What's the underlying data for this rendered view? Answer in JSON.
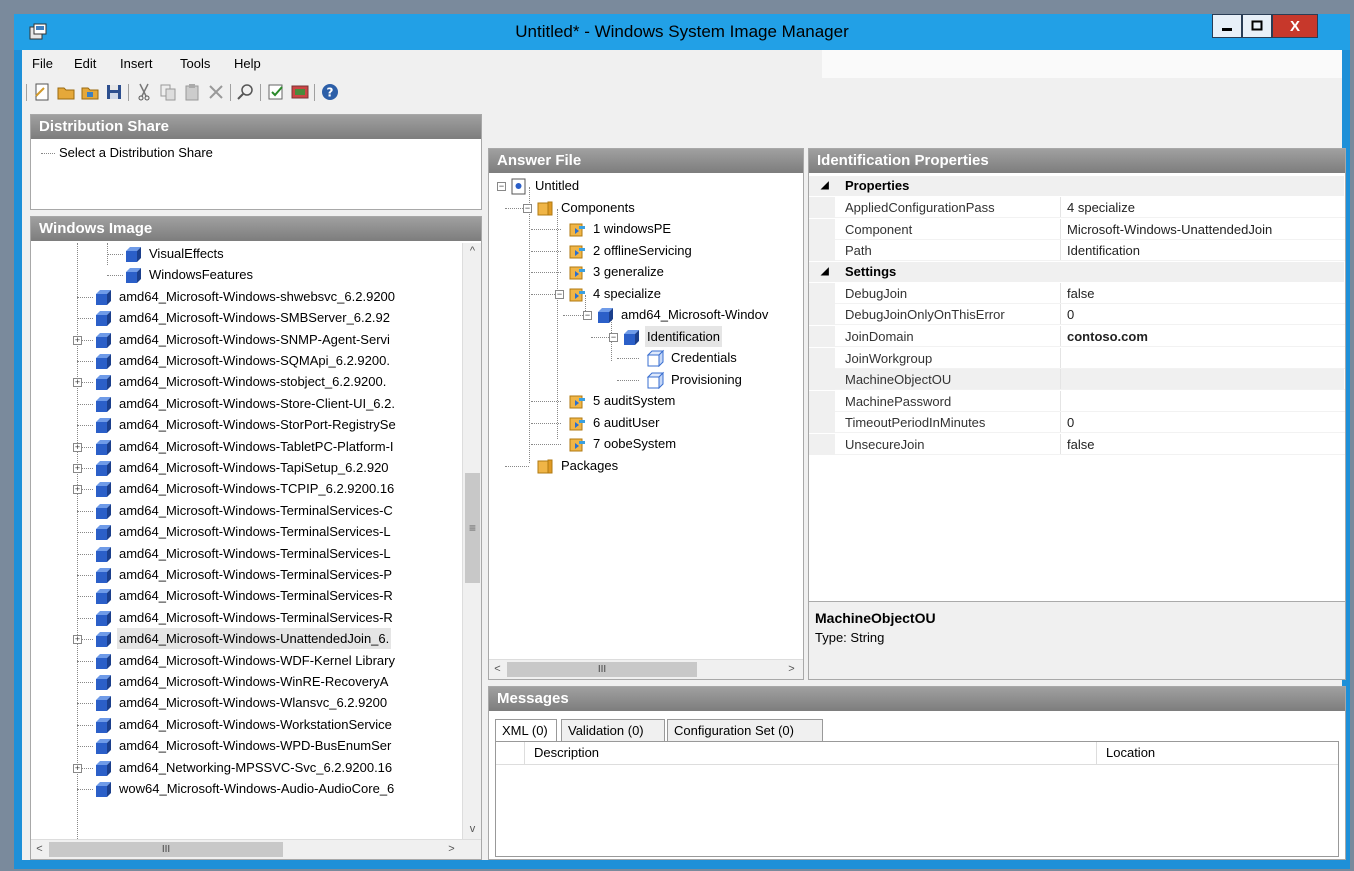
{
  "window": {
    "title": "Untitled* - Windows System Image Manager",
    "close_glyph": "X",
    "accent_color": "#22a0e6"
  },
  "menu": [
    "File",
    "Edit",
    "Insert",
    "Tools",
    "Help"
  ],
  "toolbar_icons": [
    "new-answer-file-icon",
    "open-icon",
    "open-distribution-icon",
    "save-icon",
    "cut-icon",
    "copy-icon",
    "paste-icon",
    "delete-icon",
    "find-icon",
    "validate-icon",
    "create-configuration-set-icon",
    "help-icon"
  ],
  "distribution_share": {
    "header": "Distribution Share",
    "placeholder_text": "Select a Distribution Share"
  },
  "windows_image": {
    "header": "Windows Image",
    "items": [
      {
        "label": "VisualEffects",
        "indent": 2,
        "expandable": false
      },
      {
        "label": "WindowsFeatures",
        "indent": 2,
        "expandable": false
      },
      {
        "label": "amd64_Microsoft-Windows-shwebsvc_6.2.9200",
        "indent": 1,
        "expandable": false
      },
      {
        "label": "amd64_Microsoft-Windows-SMBServer_6.2.92",
        "indent": 1,
        "expandable": false
      },
      {
        "label": "amd64_Microsoft-Windows-SNMP-Agent-Servi",
        "indent": 1,
        "expandable": true
      },
      {
        "label": "amd64_Microsoft-Windows-SQMApi_6.2.9200.",
        "indent": 1,
        "expandable": false
      },
      {
        "label": "amd64_Microsoft-Windows-stobject_6.2.9200.",
        "indent": 1,
        "expandable": true
      },
      {
        "label": "amd64_Microsoft-Windows-Store-Client-UI_6.2.",
        "indent": 1,
        "expandable": false
      },
      {
        "label": "amd64_Microsoft-Windows-StorPort-RegistrySe",
        "indent": 1,
        "expandable": false
      },
      {
        "label": "amd64_Microsoft-Windows-TabletPC-Platform-I",
        "indent": 1,
        "expandable": true
      },
      {
        "label": "amd64_Microsoft-Windows-TapiSetup_6.2.920",
        "indent": 1,
        "expandable": true
      },
      {
        "label": "amd64_Microsoft-Windows-TCPIP_6.2.9200.16",
        "indent": 1,
        "expandable": true
      },
      {
        "label": "amd64_Microsoft-Windows-TerminalServices-C",
        "indent": 1,
        "expandable": false
      },
      {
        "label": "amd64_Microsoft-Windows-TerminalServices-L",
        "indent": 1,
        "expandable": false
      },
      {
        "label": "amd64_Microsoft-Windows-TerminalServices-L",
        "indent": 1,
        "expandable": false
      },
      {
        "label": "amd64_Microsoft-Windows-TerminalServices-P",
        "indent": 1,
        "expandable": false
      },
      {
        "label": "amd64_Microsoft-Windows-TerminalServices-R",
        "indent": 1,
        "expandable": false
      },
      {
        "label": "amd64_Microsoft-Windows-TerminalServices-R",
        "indent": 1,
        "expandable": false
      },
      {
        "label": "amd64_Microsoft-Windows-UnattendedJoin_6.",
        "indent": 1,
        "expandable": true,
        "selected": true
      },
      {
        "label": "amd64_Microsoft-Windows-WDF-Kernel Library",
        "indent": 1,
        "expandable": false
      },
      {
        "label": "amd64_Microsoft-Windows-WinRE-RecoveryA",
        "indent": 1,
        "expandable": false
      },
      {
        "label": "amd64_Microsoft-Windows-Wlansvc_6.2.9200",
        "indent": 1,
        "expandable": false
      },
      {
        "label": "amd64_Microsoft-Windows-WorkstationService",
        "indent": 1,
        "expandable": false
      },
      {
        "label": "amd64_Microsoft-Windows-WPD-BusEnumSer",
        "indent": 1,
        "expandable": false
      },
      {
        "label": "amd64_Networking-MPSSVC-Svc_6.2.9200.16",
        "indent": 1,
        "expandable": true
      },
      {
        "label": "wow64_Microsoft-Windows-Audio-AudioCore_6",
        "indent": 1,
        "expandable": false
      }
    ]
  },
  "answer_file": {
    "header": "Answer File",
    "nodes": [
      {
        "label": "Untitled",
        "level": 0,
        "icon": "answer-file-icon",
        "expander": "minus"
      },
      {
        "label": "Components",
        "level": 1,
        "icon": "folder-icon",
        "expander": "minus"
      },
      {
        "label": "1 windowsPE",
        "level": 2,
        "icon": "pass-icon",
        "expander": "none"
      },
      {
        "label": "2 offlineServicing",
        "level": 2,
        "icon": "pass-icon",
        "expander": "none"
      },
      {
        "label": "3 generalize",
        "level": 2,
        "icon": "pass-icon",
        "expander": "none"
      },
      {
        "label": "4 specialize",
        "level": 2,
        "icon": "pass-icon",
        "expander": "minus"
      },
      {
        "label": "amd64_Microsoft-Windov",
        "level": 3,
        "icon": "component-icon",
        "expander": "minus"
      },
      {
        "label": "Identification",
        "level": 4,
        "icon": "setting-icon",
        "expander": "minus",
        "selected": true
      },
      {
        "label": "Credentials",
        "level": 5,
        "icon": "setting-outline-icon",
        "expander": "none"
      },
      {
        "label": "Provisioning",
        "level": 5,
        "icon": "setting-outline-icon",
        "expander": "none"
      },
      {
        "label": "5 auditSystem",
        "level": 2,
        "icon": "pass-icon",
        "expander": "none"
      },
      {
        "label": "6 auditUser",
        "level": 2,
        "icon": "pass-icon",
        "expander": "none"
      },
      {
        "label": "7 oobeSystem",
        "level": 2,
        "icon": "pass-icon",
        "expander": "none"
      },
      {
        "label": "Packages",
        "level": 1,
        "icon": "folder-icon",
        "expander": "none"
      }
    ]
  },
  "properties": {
    "header": "Identification Properties",
    "categories": [
      {
        "name": "Properties",
        "rows": [
          {
            "name": "AppliedConfigurationPass",
            "value": "4 specialize"
          },
          {
            "name": "Component",
            "value": "Microsoft-Windows-UnattendedJoin"
          },
          {
            "name": "Path",
            "value": "Identification"
          }
        ]
      },
      {
        "name": "Settings",
        "rows": [
          {
            "name": "DebugJoin",
            "value": "false"
          },
          {
            "name": "DebugJoinOnlyOnThisError",
            "value": "0"
          },
          {
            "name": "JoinDomain",
            "value": "contoso.com",
            "bold": true
          },
          {
            "name": "JoinWorkgroup",
            "value": ""
          },
          {
            "name": "MachineObjectOU",
            "value": "",
            "selected": true
          },
          {
            "name": "MachinePassword",
            "value": ""
          },
          {
            "name": "TimeoutPeriodInMinutes",
            "value": "0"
          },
          {
            "name": "UnsecureJoin",
            "value": "false"
          }
        ]
      }
    ],
    "description": {
      "title": "MachineObjectOU",
      "type": "Type: String"
    }
  },
  "messages": {
    "header": "Messages",
    "tabs": [
      "XML (0)",
      "Validation (0)",
      "Configuration Set (0)"
    ],
    "columns": [
      "Description",
      "Location"
    ]
  },
  "scroll_glyphs": {
    "up": "^",
    "down": "v",
    "left": "<",
    "right": ">",
    "grip_h": "III",
    "grip_v": "≡"
  }
}
